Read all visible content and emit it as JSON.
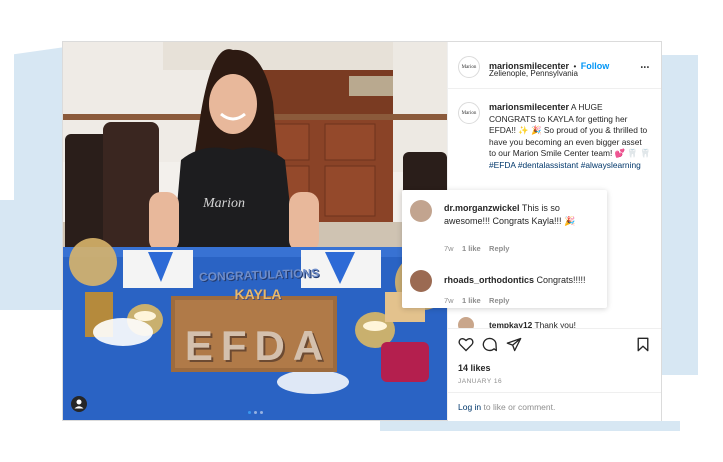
{
  "post": {
    "account": "marionsmilecenter",
    "separator": "•",
    "follow_label": "Follow",
    "location": "Zelienople, Pennsylvania",
    "more_label": "•••",
    "logo_text": "Marion",
    "caption_user": "marionsmilecenter",
    "caption_text": "A HUGE CONGRATS to KAYLA for getting her EFDA!! ✨ 🎉 So proud of you & thrilled to have you becoming an even bigger asset to our Marion Smile Center team! 💕 🦷 🦷 ",
    "caption_tags": "#EFDA #dentalassistant #alwayslearning",
    "photo_banner": "CONGRATULATIONS",
    "photo_name": "KAYLA",
    "photo_cake_text": "EFDA",
    "likes": "14 likes",
    "date": "JANUARY 16",
    "login_link": "Log in",
    "login_rest": " to like or comment."
  },
  "comments": [
    {
      "user": "dr.morganzwickel",
      "text": "This is so awesome!!! Congrats Kayla!!! 🎉",
      "age": "7w",
      "likes": "1 like",
      "reply": "Reply"
    },
    {
      "user": "rhoads_orthodontics",
      "text": "Congrats!!!!!",
      "age": "7w",
      "likes": "1 like",
      "reply": "Reply"
    }
  ],
  "partial_comment": {
    "user": "tempkay12",
    "text": "Thank you!"
  },
  "colors": {
    "accent": "#0095f6",
    "tablecloth": "#2a63c4",
    "brush": "#d7e7f3"
  },
  "icons": [
    "heart-icon",
    "comment-icon",
    "share-icon",
    "bookmark-icon",
    "chevron-right-icon",
    "user-tag-icon"
  ]
}
